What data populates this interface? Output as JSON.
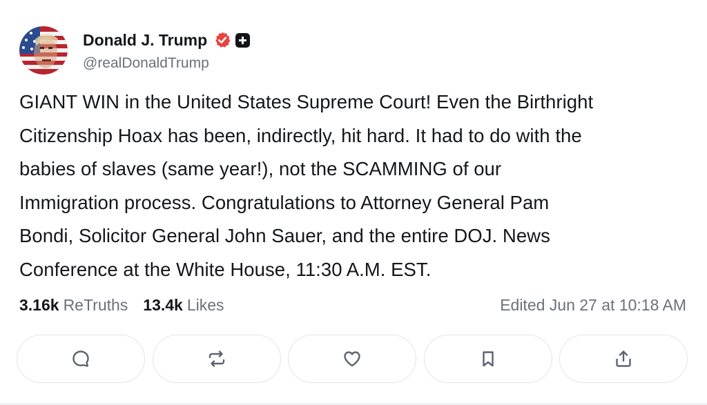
{
  "author": {
    "display_name": "Donald J. Trump",
    "handle": "@realDonaldTrump",
    "verified_badge_color": "#e8423f"
  },
  "post": {
    "text": "GIANT WIN in the United States Supreme Court! Even the Birthright Citizenship Hoax has been, indirectly, hit hard. It had to do with the babies of slaves (same year!), not the SCAMMING of our Immigration process. Congratulations to Attorney General Pam Bondi, Solicitor General John Sauer, and the entire DOJ. News Conference at the White House, 11:30 A.M. EST.",
    "lines": [
      "GIANT WIN in the United States Supreme Court! Even the Birthright",
      "Citizenship Hoax has been, indirectly, hit hard. It had to do with the",
      "babies of slaves (same year!), not the SCAMMING of our",
      "Immigration process. Congratulations to Attorney General Pam",
      "Bondi, Solicitor General John Sauer, and the entire DOJ. News",
      "Conference at the White House, 11:30 A.M. EST."
    ]
  },
  "stats": {
    "retruths_count": "3.16k",
    "retruths_label": "ReTruths",
    "likes_count": "13.4k",
    "likes_label": "Likes",
    "edited": "Edited Jun 27 at 10:18 AM"
  },
  "actions": [
    {
      "icon": "reply-icon"
    },
    {
      "icon": "retruth-icon"
    },
    {
      "icon": "like-heart-icon"
    },
    {
      "icon": "bookmark-icon"
    },
    {
      "icon": "share-icon"
    }
  ],
  "colors": {
    "text": "#14161a",
    "muted": "#6b7079",
    "border": "#e2e4e8",
    "icon": "#5b6270"
  }
}
